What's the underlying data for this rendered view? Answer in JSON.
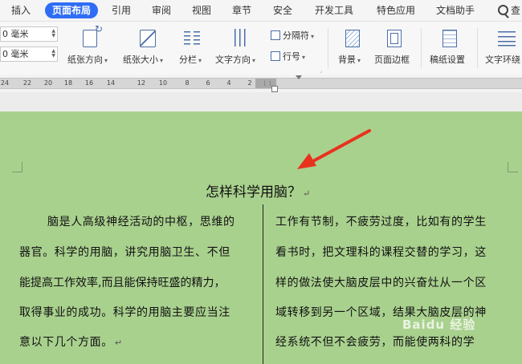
{
  "menu": {
    "tabs": [
      "插入",
      "页面布局",
      "引用",
      "审阅",
      "视图",
      "章节",
      "安全",
      "开发工具",
      "特色应用",
      "文档助手"
    ],
    "active_tab": "页面布局",
    "search_label": "查"
  },
  "ribbon": {
    "margin_top": "0 毫米",
    "margin_bottom": "0 毫米",
    "orientation": "纸张方向",
    "size": "纸张大小",
    "columns": "分栏",
    "text_direction": "文字方向",
    "separator": "分隔符",
    "line_numbers": "行号",
    "background": "背景",
    "page_border": "页面边框",
    "grid_paper": "稿纸设置",
    "text_wrap": "文字环绕"
  },
  "ruler": {
    "ticks": [
      "24",
      "22",
      "20",
      "18",
      "16",
      "14",
      "12",
      "10",
      "8",
      "6",
      "4",
      "2"
    ]
  },
  "document": {
    "title": "怎样科学用脑？",
    "left_column": [
      "脑是人高级神经活动的中枢，思维的",
      "器官。科学的用脑，讲究用脑卫生、不但",
      "能提高工作效率,而且能保持旺盛的精力，",
      "取得事业的成功。科学的用脑主要应当注",
      "意以下几个方面。"
    ],
    "right_column": [
      "工作有节制，不疲劳过度，比如有的学生",
      "看书时，把文理科的课程交替的学习，这",
      "样的做法使大脑皮层中的兴奋灶从一个区",
      "域转移到另一个区域，结果大脑皮层的神",
      "经系统不但不会疲劳，而能使两科的学"
    ],
    "paragraph_mark": "↵",
    "arrow_color": "#e8321e",
    "page_color": "#a9d18e"
  },
  "watermark": "Baidu 经验"
}
